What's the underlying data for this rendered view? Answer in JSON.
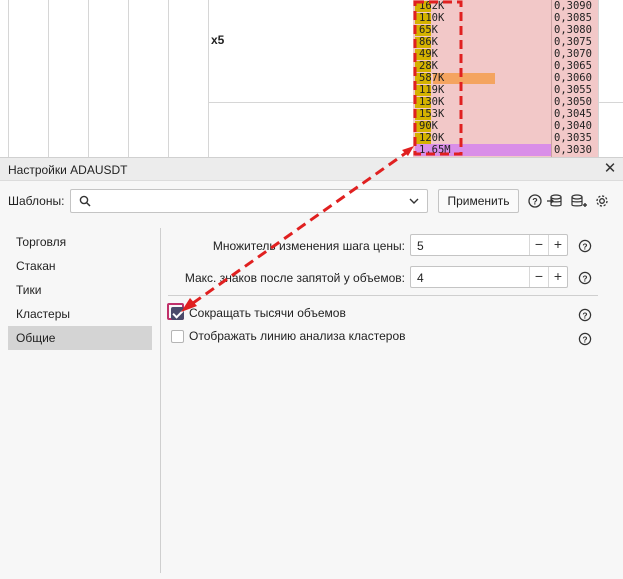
{
  "chart": {
    "multiplier_label": "x5",
    "rows": [
      {
        "volume": "162K",
        "price": "0,3090"
      },
      {
        "volume": "110K",
        "price": "0,3085"
      },
      {
        "volume": "65K",
        "price": "0,3080"
      },
      {
        "volume": "86K",
        "price": "0,3075"
      },
      {
        "volume": "49K",
        "price": "0,3070"
      },
      {
        "volume": "28K",
        "price": "0,3065"
      },
      {
        "volume": "587K",
        "price": "0,3060"
      },
      {
        "volume": "119K",
        "price": "0,3055"
      },
      {
        "volume": "130K",
        "price": "0,3050"
      },
      {
        "volume": "153K",
        "price": "0,3045"
      },
      {
        "volume": "90K",
        "price": "0,3040"
      },
      {
        "volume": "120K",
        "price": "0,3035"
      },
      {
        "volume": "1.65M",
        "price": "0,3030"
      }
    ],
    "colors": {
      "cell_bg": "#f2c8c8",
      "volume_bar": "#d4b200",
      "max_volume": "#f4a460",
      "poc": "#d98ee8",
      "annotation": "#e02020"
    }
  },
  "dialog": {
    "title": "Настройки ADAUSDT",
    "close_icon": "close-icon",
    "templates_label": "Шаблоны:",
    "templates_value": "",
    "apply_label": "Применить",
    "toolbar_icons": [
      "help-icon",
      "load-template-icon",
      "save-template-icon",
      "gear-icon"
    ],
    "sidebar": {
      "items": [
        {
          "label": "Торговля",
          "active": false
        },
        {
          "label": "Стакан",
          "active": false
        },
        {
          "label": "Тики",
          "active": false
        },
        {
          "label": "Кластеры",
          "active": false
        },
        {
          "label": "Общие",
          "active": true
        }
      ]
    },
    "settings": {
      "step_multiplier": {
        "label": "Множитель изменения шага цены:",
        "value": "5"
      },
      "volume_decimals": {
        "label": "Макс. знаков после запятой у объемов:",
        "value": "4"
      },
      "shorten_thousands": {
        "label": "Сокращать тысячи объемов",
        "checked": true
      },
      "show_analysis_line": {
        "label": "Отображать линию анализа кластеров",
        "checked": false
      }
    },
    "accent_color": "#4a4a6a"
  }
}
